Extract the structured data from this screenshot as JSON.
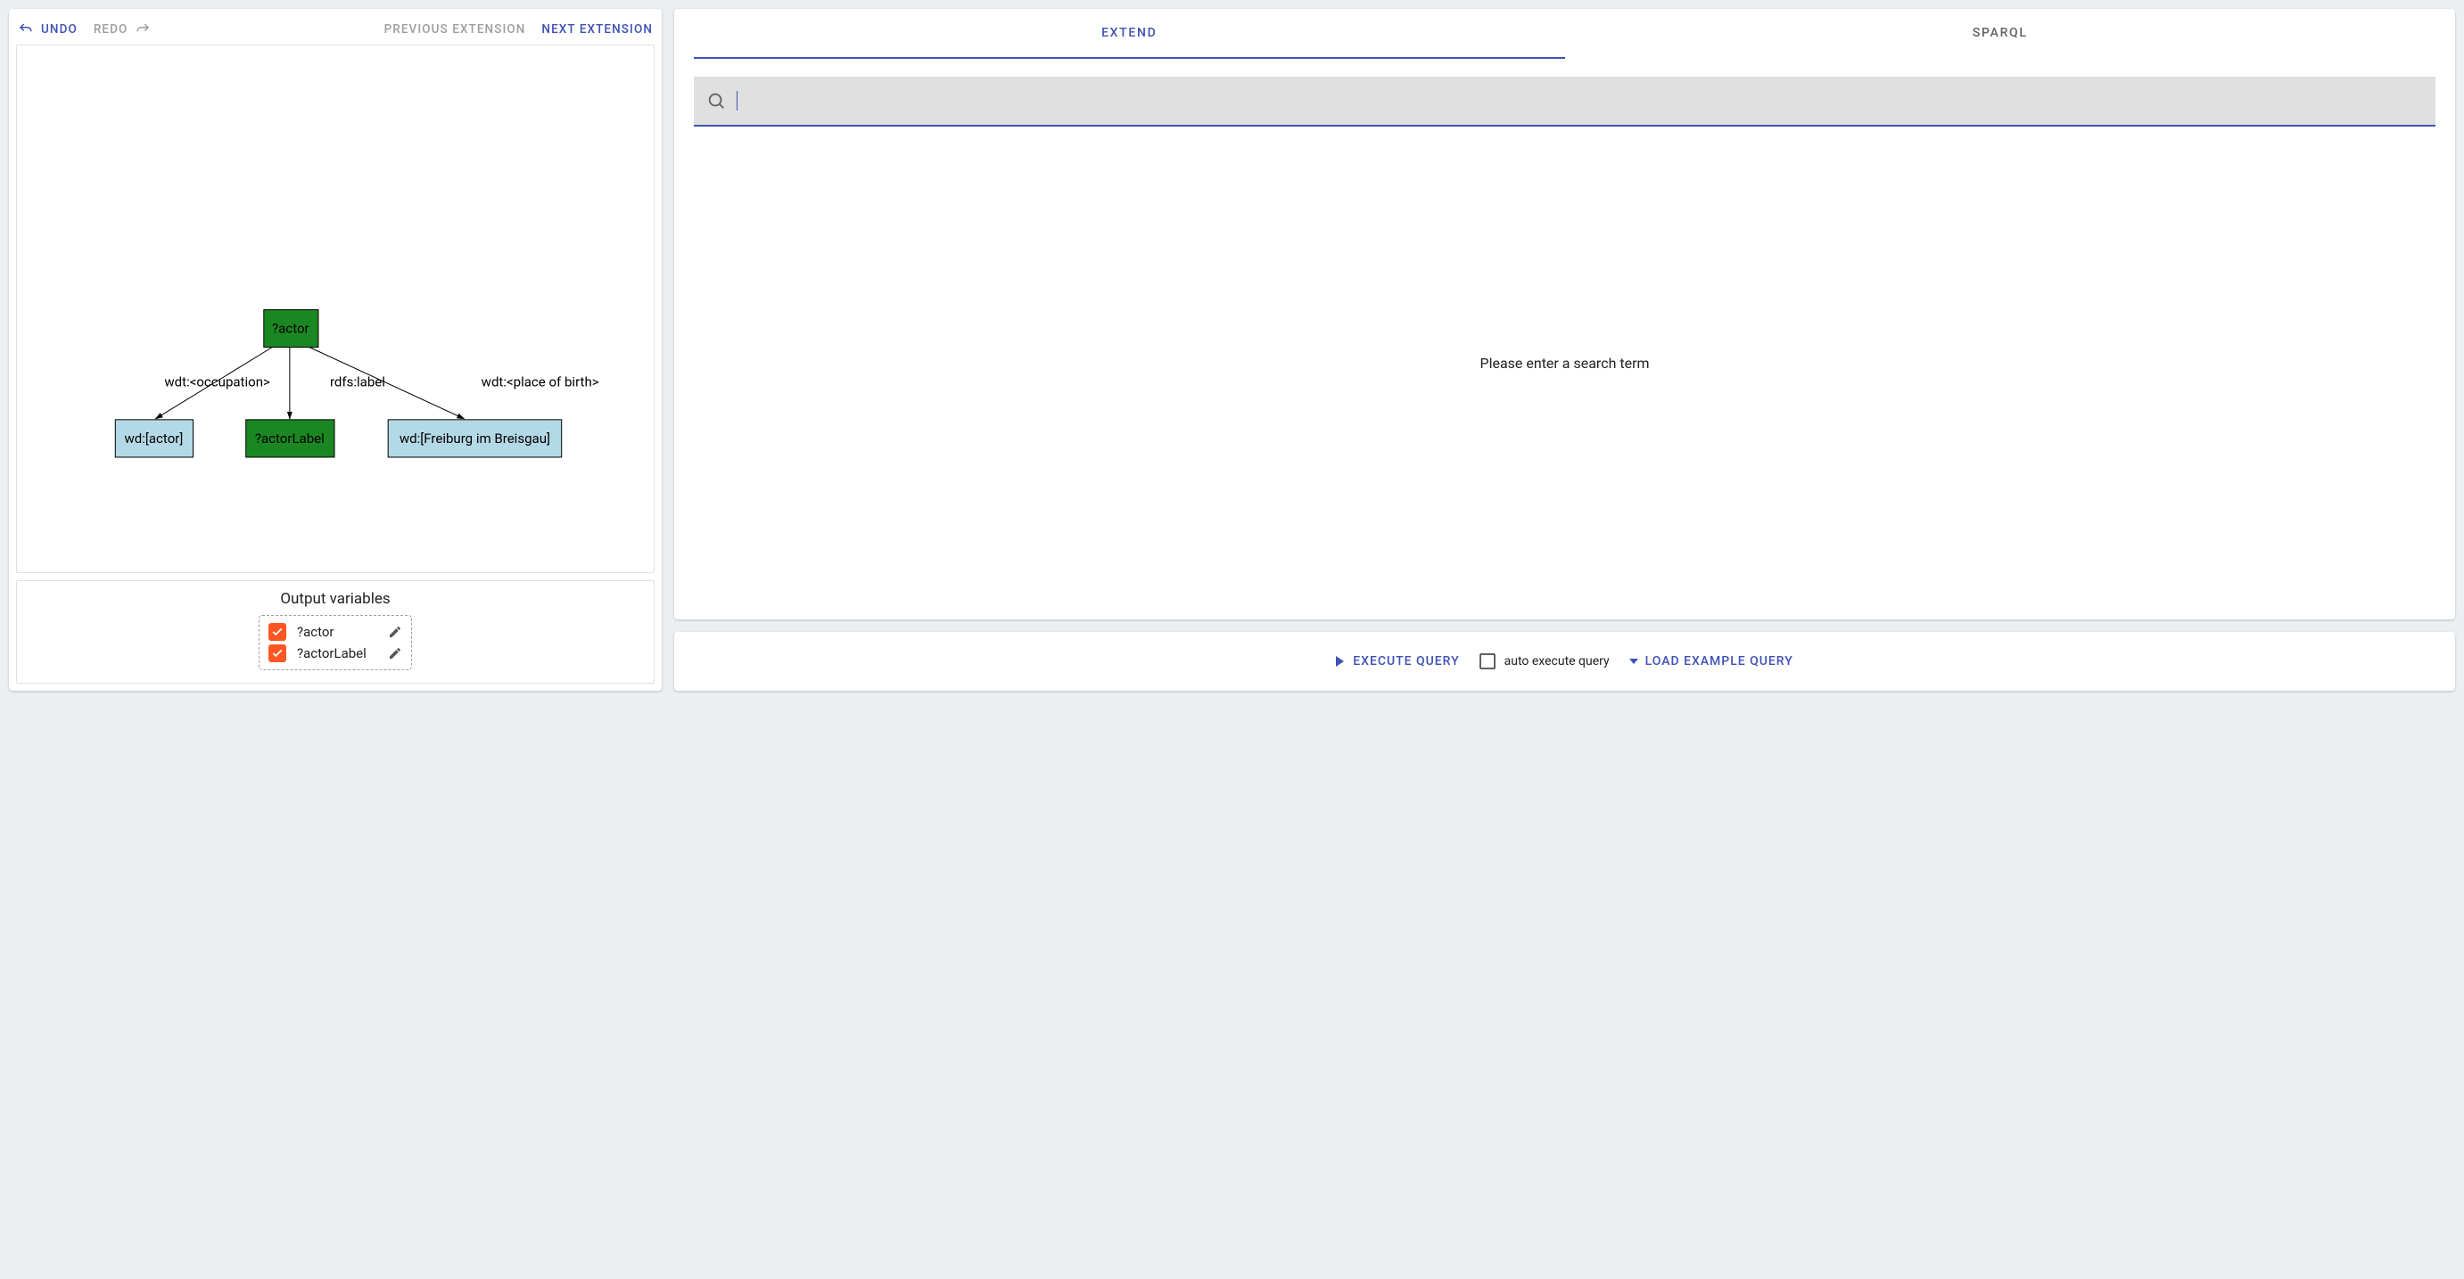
{
  "toolbar": {
    "undo": "UNDO",
    "redo": "REDO",
    "prev": "PREVIOUS EXTENSION",
    "next": "NEXT EXTENSION"
  },
  "graph": {
    "root": {
      "label": "?actor"
    },
    "edges": [
      {
        "label": "wdt:<occupation>"
      },
      {
        "label": "rdfs:label"
      },
      {
        "label": "wdt:<place of birth>"
      }
    ],
    "children": [
      {
        "label": "wd:[actor]",
        "type": "literal"
      },
      {
        "label": "?actorLabel",
        "type": "var"
      },
      {
        "label": "wd:[Freiburg im Breisgau]",
        "type": "literal"
      }
    ]
  },
  "output": {
    "title": "Output variables",
    "vars": [
      {
        "label": "?actor"
      },
      {
        "label": "?actorLabel"
      }
    ]
  },
  "tabs": {
    "extend": "EXTEND",
    "sparql": "SPARQL"
  },
  "search": {
    "placeholder_msg": "Please enter a search term"
  },
  "actions": {
    "execute": "EXECUTE QUERY",
    "auto": "auto execute query",
    "load": "LOAD EXAMPLE QUERY"
  }
}
